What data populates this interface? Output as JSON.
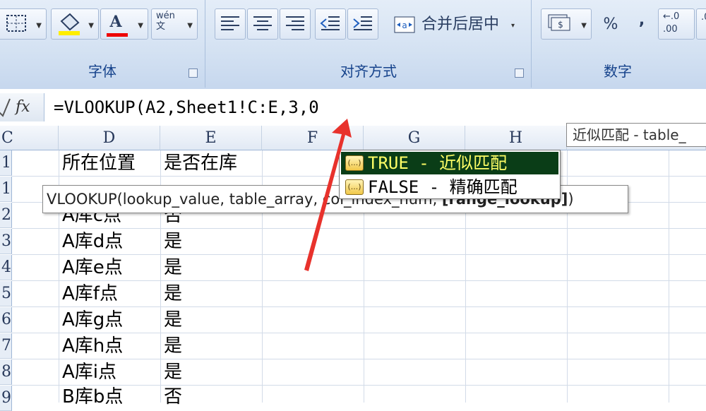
{
  "ribbon": {
    "groups": [
      {
        "label": "字体"
      },
      {
        "label": "对齐方式",
        "merge_label": "合并后居中"
      },
      {
        "label": "数字",
        "percent": "%",
        "comma": ",",
        "decimal": "←.0\n.00"
      }
    ],
    "font_color_glyph": "A",
    "phonetic_glyph": "wén\n文"
  },
  "formula_bar": {
    "fx": "fx",
    "formula": "=VLOOKUP(A2,Sheet1!C:E,3,0"
  },
  "grid": {
    "columns": [
      "C",
      "D",
      "E",
      "F",
      "G",
      "H"
    ],
    "rows": [
      {
        "num": "1",
        "d": "所在位置",
        "e": "是否在库"
      },
      {
        "num": "1",
        "d": "",
        "e": ""
      },
      {
        "num": "2",
        "d": "A库c点",
        "e": "否"
      },
      {
        "num": "3",
        "d": "A库d点",
        "e": "是"
      },
      {
        "num": "4",
        "d": "A库e点",
        "e": "是"
      },
      {
        "num": "5",
        "d": "A库f点",
        "e": "是"
      },
      {
        "num": "6",
        "d": "A库g点",
        "e": "是"
      },
      {
        "num": "7",
        "d": "A库h点",
        "e": "是"
      },
      {
        "num": "8",
        "d": "A库i点",
        "e": "是"
      },
      {
        "num": "9",
        "d": "B库b点",
        "e": "否"
      }
    ]
  },
  "tooltip": {
    "prefix": "VLOOKUP(lookup_value, table_ar",
    "hidden_mid": "ray, col_index_num, ",
    "bold": "[range_lookup]",
    "suffix": ")"
  },
  "topright_hint": "近似匹配 - table_",
  "autocomplete": {
    "icon_text": "(...)",
    "items": [
      {
        "label": "TRUE - 近似匹配"
      },
      {
        "label": "FALSE - 精确匹配"
      }
    ]
  },
  "colors": {
    "accent_red": "#e8322c",
    "selected_bg": "#0a3d17",
    "ribbon_label": "#15428b"
  }
}
